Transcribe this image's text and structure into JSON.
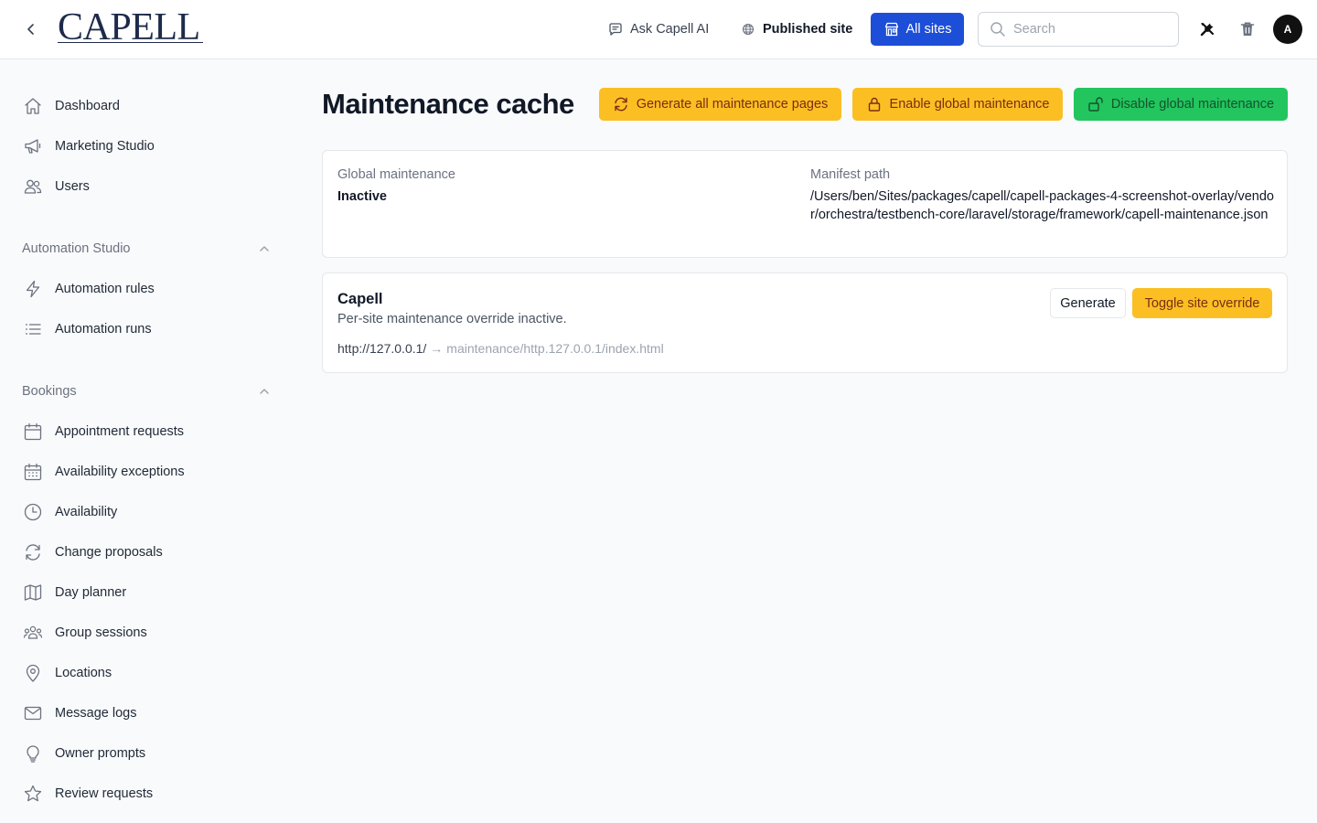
{
  "header": {
    "logo": "CAPELL",
    "ask_ai": "Ask Capell AI",
    "published_site": "Published site",
    "all_sites": "All sites",
    "search_placeholder": "Search",
    "avatar_initial": "A"
  },
  "sidebar": {
    "items": [
      {
        "label": "Dashboard",
        "icon": "home-icon"
      },
      {
        "label": "Marketing Studio",
        "icon": "megaphone-icon"
      },
      {
        "label": "Users",
        "icon": "users-icon"
      }
    ],
    "groups": [
      {
        "label": "Automation Studio",
        "items": [
          {
            "label": "Automation rules",
            "icon": "bolt-icon"
          },
          {
            "label": "Automation runs",
            "icon": "list-icon"
          }
        ]
      },
      {
        "label": "Bookings",
        "items": [
          {
            "label": "Appointment requests",
            "icon": "calendar-icon"
          },
          {
            "label": "Availability exceptions",
            "icon": "calendar-days-icon"
          },
          {
            "label": "Availability",
            "icon": "clock-icon"
          },
          {
            "label": "Change proposals",
            "icon": "refresh-icon"
          },
          {
            "label": "Day planner",
            "icon": "map-icon"
          },
          {
            "label": "Group sessions",
            "icon": "user-group-icon"
          },
          {
            "label": "Locations",
            "icon": "map-pin-icon"
          },
          {
            "label": "Message logs",
            "icon": "envelope-icon"
          },
          {
            "label": "Owner prompts",
            "icon": "lightbulb-icon"
          },
          {
            "label": "Review requests",
            "icon": "star-icon"
          }
        ]
      }
    ]
  },
  "main": {
    "title": "Maintenance cache",
    "generate_all": "Generate all maintenance pages",
    "enable_global": "Enable global maintenance",
    "disable_global": "Disable global maintenance",
    "global_maintenance_label": "Global maintenance",
    "global_maintenance_value": "Inactive",
    "manifest_path_label": "Manifest path",
    "manifest_path_value": "/Users/ben/Sites/packages/capell/capell-packages-4-screenshot-overlay/vendor/orchestra/testbench-core/laravel/storage/framework/capell-maintenance.json",
    "site": {
      "name": "Capell",
      "description": "Per-site maintenance override inactive.",
      "url": "http://127.0.0.1/",
      "arrow": "→",
      "path": "maintenance/http.127.0.0.1/index.html",
      "generate": "Generate",
      "toggle": "Toggle site override"
    }
  },
  "colors": {
    "primary": "#1d4ed8",
    "amber": "#fbbf24",
    "green": "#22c55e"
  }
}
